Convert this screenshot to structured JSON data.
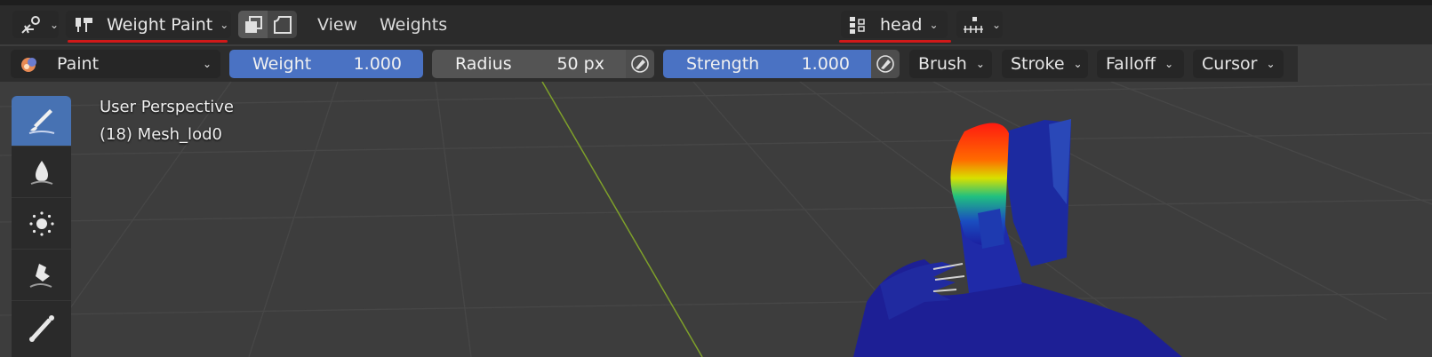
{
  "header": {
    "editor_type_icon": "weight-paint-editor-icon",
    "mode_label": "Weight Paint",
    "menus": [
      "View",
      "Weights"
    ],
    "vertex_group_label": "head"
  },
  "tool_settings": {
    "brush_name": "Paint",
    "weight": {
      "label": "Weight",
      "value": "1.000"
    },
    "radius": {
      "label": "Radius",
      "value": "50 px"
    },
    "strength": {
      "label": "Strength",
      "value": "1.000"
    },
    "menus": [
      "Brush",
      "Stroke",
      "Falloff",
      "Cursor"
    ]
  },
  "viewport": {
    "view_name": "User Perspective",
    "object_info": "(18) Mesh_lod0"
  },
  "toolbar": {
    "tools": [
      "draw-brush-icon",
      "blur-drop-icon",
      "average-icon",
      "smear-icon",
      "gradient-icon"
    ],
    "active_tool": "draw-brush-icon"
  },
  "colors": {
    "accent": "#4772b3",
    "slider_blue": "#4a72c3",
    "underline_red": "#d11919",
    "viewport_bg": "#3d3d3d",
    "y_axis": "#7ea02a"
  }
}
